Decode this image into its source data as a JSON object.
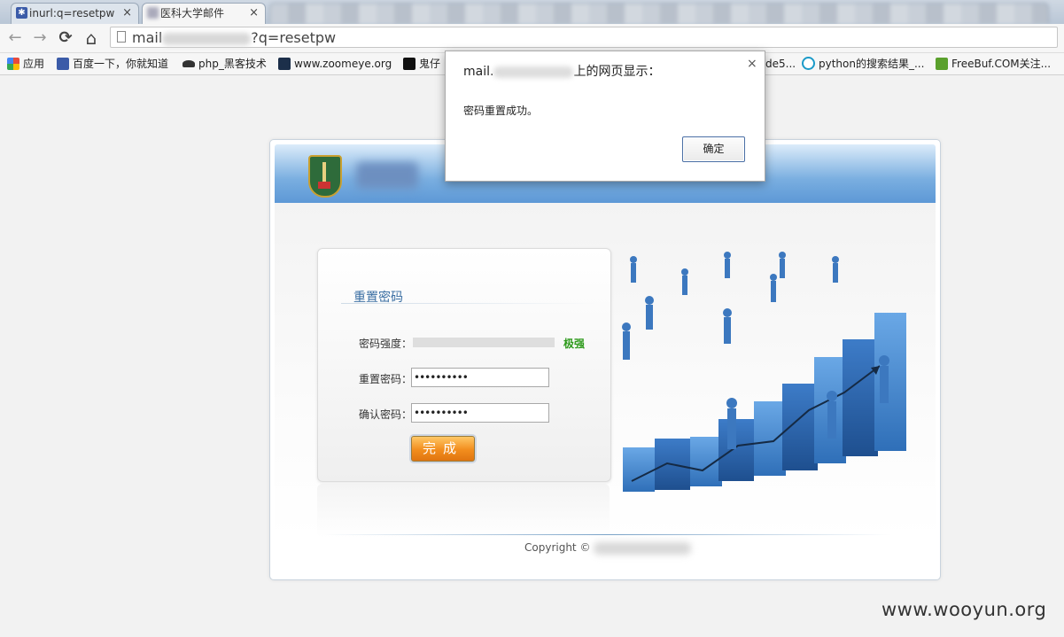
{
  "browser": {
    "tabs": [
      {
        "title": "inurl:q=resetpw",
        "close": "×"
      },
      {
        "title": "医科大学邮件",
        "close": "×"
      }
    ],
    "url_prefix": "mail",
    "url_suffix": "?q=resetpw",
    "nav_back": "←",
    "nav_forward": "→",
    "nav_reload": "⟳",
    "nav_home": "⌂"
  },
  "bookmarks": [
    {
      "label": "应用",
      "color": "#e84a3c"
    },
    {
      "label": "百度一下，你就知道",
      "color": "#3b5ba8"
    },
    {
      "label": "php_黑客技术",
      "color": "#333333"
    },
    {
      "label": "www.zoomeye.org",
      "color": "#1c2f4a"
    },
    {
      "label": "鬼仔",
      "color": "#111111"
    },
    {
      "label": "de5...",
      "color": "#777777"
    },
    {
      "label": "python的搜索结果_...",
      "color": "#1b9ac8"
    },
    {
      "label": "FreeBuf.COM关注...",
      "color": "#5aa02c"
    }
  ],
  "page": {
    "form_title": "重置密码",
    "strength_label": "密码强度：",
    "strength_value": "极强",
    "strength_fraction": 1.0,
    "reset_label": "重置密码：",
    "reset_value": "••••••••••",
    "confirm_label": "确认密码：",
    "confirm_value": "••••••••••",
    "submit_label": "完成",
    "copyright": "Copyright ©"
  },
  "dialog": {
    "title_prefix": "mail.",
    "title_suffix": "上的网页显示：",
    "message": "密码重置成功。",
    "ok_label": "确定",
    "close": "×"
  },
  "watermark": "www.wooyun.org",
  "colors": {
    "accent": "#3b6fa3",
    "strength": "#2d9a1b",
    "button": "#f28d1d"
  }
}
